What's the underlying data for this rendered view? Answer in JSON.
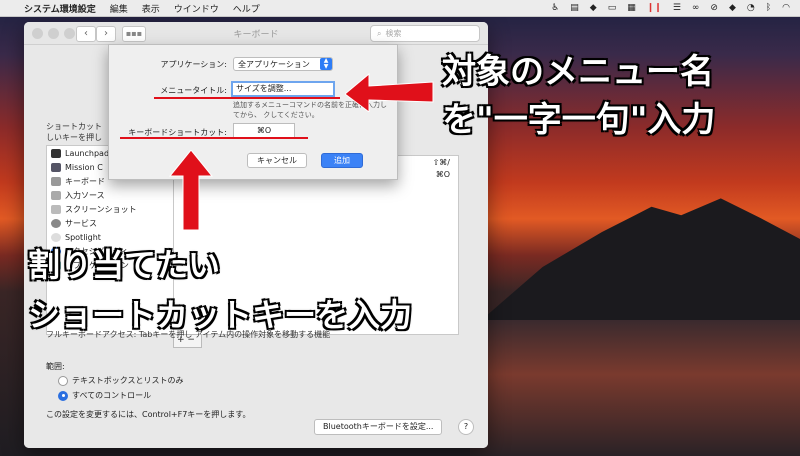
{
  "menubar": {
    "apple": "",
    "app_name": "システム環境設定",
    "menus": [
      "編集",
      "表示",
      "ウインドウ",
      "ヘルプ"
    ]
  },
  "window": {
    "title": "キーボード",
    "search_placeholder": "検索",
    "pane_desc_line1": "ショートカット",
    "pane_desc_line2": "しいキーを押し",
    "left_items": [
      "Launchpad",
      "Mission C",
      "キーボード",
      "入力ソース",
      "スクリーンショット",
      "サービス",
      "Spotlight",
      "アクセシビリティ",
      "アプリケーション"
    ],
    "shortcut_1": "⇧⌘/",
    "shortcut_2": "⌘O",
    "fka_text": "フルキーボードアクセス: Tabキーを押し              アイテム内の操作対象を移動する機能",
    "range_label": "範囲:",
    "radio_1": "テキストボックスとリストのみ",
    "radio_2": "すべてのコントロール",
    "ctrl_note": "この設定を変更するには、Control+F7キーを押します。",
    "bluetooth_button": "Bluetoothキーボードを設定...",
    "help": "?"
  },
  "sheet": {
    "app_label": "アプリケーション:",
    "app_value": "全アプリケーション",
    "menu_title_label": "メニュータイトル:",
    "menu_title_value": "サイズを調整...",
    "helper_text": "追加するメニューコマンドの名前を正確に入力してから、          クしてください。",
    "shortcut_label": "キーボードショートカット:",
    "shortcut_value": "⌘O",
    "cancel": "キャンセル",
    "add": "追加"
  },
  "annotations": {
    "right_line1": "対象のメニュー名",
    "right_line2": "を\"一字一句\"入力",
    "bottom_line1": "割り当てたい",
    "bottom_line2": "ショートカットキーを入力"
  },
  "colors": {
    "accent": "#3b82f6",
    "annotation_red": "#e0101a"
  }
}
